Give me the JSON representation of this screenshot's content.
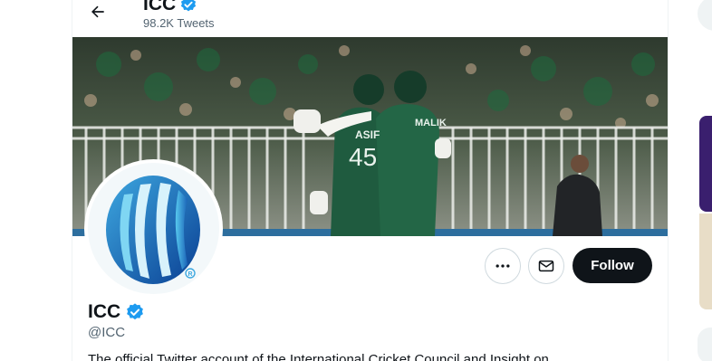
{
  "header": {
    "title": "ICC",
    "tweets_count": "98.2K Tweets"
  },
  "banner": {
    "player_left_name": "ASIF",
    "player_left_number": "45",
    "player_right_name": "MALIK"
  },
  "actions": {
    "follow_label": "Follow"
  },
  "profile": {
    "name": "ICC",
    "handle": "@ICC",
    "bio": "The official Twitter account of the International Cricket Council and Insight on"
  },
  "colors": {
    "verified": "#1d9bf0",
    "follow_bg": "#0f1419",
    "muted_text": "#536471",
    "border": "#cfd9de",
    "pakistan_green": "#1f5b3f"
  }
}
